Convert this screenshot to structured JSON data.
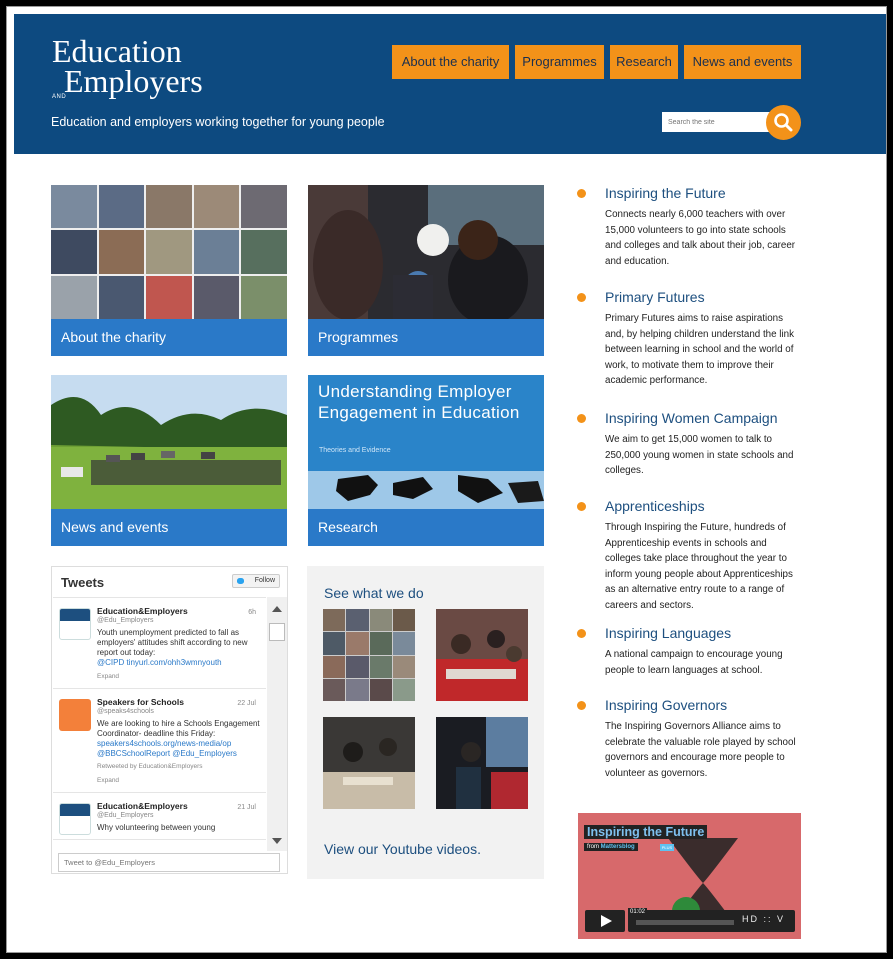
{
  "site": {
    "logo_line1": "Education",
    "logo_and": "AND",
    "logo_line2": "Employers",
    "tagline": "Education and employers working together for young people"
  },
  "nav": [
    {
      "label": "About the charity"
    },
    {
      "label": "Programmes"
    },
    {
      "label": "Research"
    },
    {
      "label": "News and events"
    }
  ],
  "search": {
    "placeholder": "Search the site"
  },
  "tiles": {
    "about": "About the charity",
    "programmes": "Programmes",
    "news": "News and events",
    "research": "Research",
    "research_cover_title": "Understanding Employer Engagement in Education",
    "research_cover_sub": "Theories and Evidence"
  },
  "tweets": {
    "title": "Tweets",
    "follow": "Follow",
    "compose_placeholder": "Tweet to @Edu_Employers",
    "items": [
      {
        "name": "Education&Employers",
        "handle": "@Edu_Employers",
        "date": "6h",
        "text": "Youth unemployment predicted to fall as employers' attitudes shift according to new report out today:",
        "links": "@CIPD  tinyurl.com/ohh3wmnyouth",
        "meta": "",
        "expand": "Expand"
      },
      {
        "name": "Speakers for Schools",
        "handle": "@speaks4schools",
        "date": "22 Jul",
        "text": "We are looking to hire a Schools Engagement Coordinator- deadline this Friday:",
        "links": "speakers4schools.org/news-media/op @BBCSchoolReport @Edu_Employers",
        "meta": "Retweeted by Education&Employers",
        "expand": "Expand"
      },
      {
        "name": "Education&Employers",
        "handle": "@Edu_Employers",
        "date": "21 Jul",
        "text": "Why volunteering between young",
        "links": "",
        "meta": "",
        "expand": ""
      }
    ]
  },
  "see_what_we_do": {
    "title": "See what we do",
    "youtube_link": "View our Youtube videos."
  },
  "programmes": [
    {
      "title": "Inspiring the Future",
      "desc": "Connects nearly 6,000 teachers with over 15,000 volunteers to go into state schools and colleges and talk about their job, career and education."
    },
    {
      "title": "Primary Futures",
      "desc": "Primary Futures aims to raise aspirations and, by helping children understand the link between learning in school and the world of work, to motivate them to improve their academic performance."
    },
    {
      "title": "Inspiring Women Campaign",
      "desc": "We aim to get 15,000 women to talk to 250,000 young women in state schools and colleges."
    },
    {
      "title": "Apprenticeships",
      "desc": "Through Inspiring the Future, hundreds of Apprenticeship events in schools and colleges take place throughout the year to inform young people about Apprenticeships as an alternative entry route to a range of careers and sectors."
    },
    {
      "title": "Inspiring Languages",
      "desc": "A national campaign to encourage young people to learn languages at school."
    },
    {
      "title": "Inspiring Governors",
      "desc": "The Inspiring Governors Alliance aims to celebrate the valuable role played by school governors and encourage more people to volunteer as governors."
    }
  ],
  "video": {
    "title": "Inspiring the Future",
    "from_label": "from",
    "from_name": "Mattersblog",
    "plus": "PLUS",
    "time": "01:02",
    "controls": "HD :: V"
  },
  "colors": {
    "header": "#0d4a80",
    "accent": "#f39219",
    "caption": "#2a79c8",
    "link": "#1d4f7f"
  }
}
